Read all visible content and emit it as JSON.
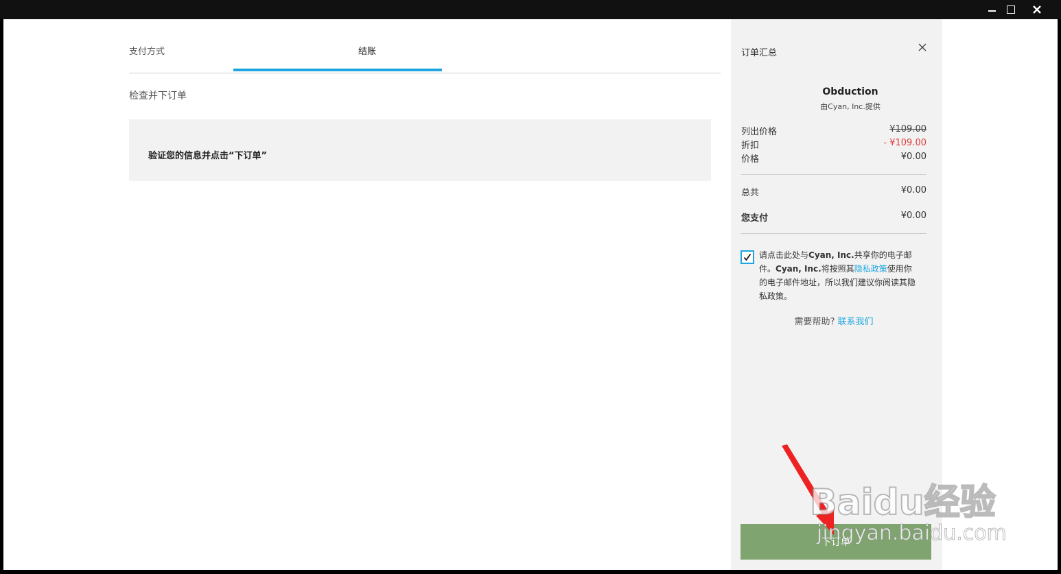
{
  "window": {
    "minimize_icon": "minimize-icon",
    "maximize_icon": "maximize-icon",
    "close_icon": "close-icon"
  },
  "tabs": [
    {
      "label": "支付方式"
    },
    {
      "label": "结账",
      "active": true
    }
  ],
  "main": {
    "section_title": "检查并下订单",
    "verify_prefix": "验证您的信息并点击“下订单”"
  },
  "summary": {
    "title": "订单汇总",
    "product_name": "Obduction",
    "publisher": "由Cyan, Inc.提供",
    "list_price_label": "列出价格",
    "list_price": "¥109.00",
    "discount_label": "折扣",
    "discount": "- ¥109.00",
    "price_label": "价格",
    "price": "¥0.00",
    "total_label": "总共",
    "total": "¥0.00",
    "you_pay_label": "您支付",
    "you_pay": "¥0.00",
    "consent_checked": true,
    "consent_1": "请点击此处与",
    "consent_company": "Cyan, Inc.",
    "consent_2": "共享你的电子邮件。",
    "consent_company_2": "Cyan, Inc.",
    "consent_3": "将按照其",
    "privacy_link": "隐私政策",
    "consent_4": "使用你的电子邮件地址，所以我们建议你阅读其隐私政策。",
    "help_text": "需要帮助?",
    "contact_link": "联系我们",
    "place_order": "下订单"
  },
  "watermark": {
    "brand": "Baidu经验",
    "url": "jingyan.baidu.com"
  },
  "colors": {
    "accent": "#1ea5e0",
    "button": "#7fa46f",
    "discount": "#e03c3c"
  }
}
